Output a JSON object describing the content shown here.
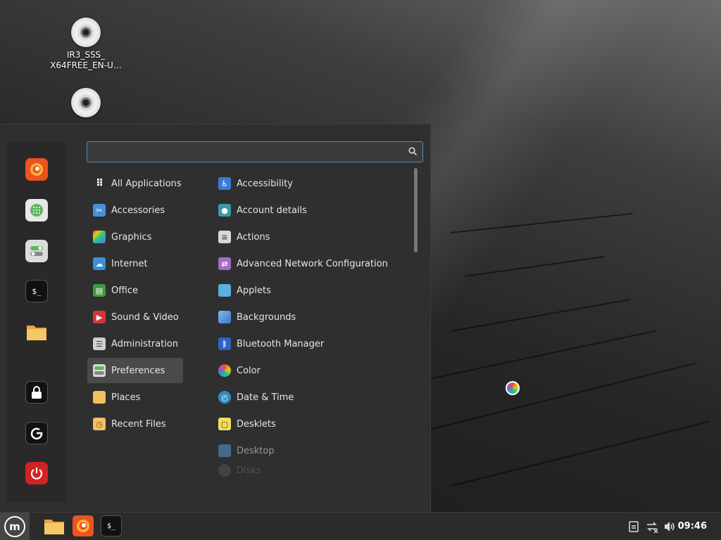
{
  "desktop": {
    "icons": [
      {
        "label": "IR3_SSS_\nX64FREE_EN-U…",
        "icon": "optical-disc-icon"
      },
      {
        "label": "",
        "icon": "optical-disc-icon"
      }
    ]
  },
  "menu": {
    "search": {
      "value": "",
      "placeholder": "",
      "icon": "search-icon"
    },
    "favorites": [
      {
        "name": "Firefox",
        "icon": "firefox-icon",
        "color": "#e95420"
      },
      {
        "name": "Software Manager",
        "icon": "software-manager-icon",
        "color": "#5cb85c"
      },
      {
        "name": "System Settings",
        "icon": "settings-toggle-icon",
        "color": "#d8d8d8"
      },
      {
        "name": "Terminal",
        "icon": "terminal-icon",
        "color": "#1e1e1e"
      },
      {
        "name": "Files",
        "icon": "folder-icon",
        "color": "#f3c060"
      },
      {
        "name": "Lock Screen",
        "icon": "lock-icon",
        "color": "#1a1a1a"
      },
      {
        "name": "Logout",
        "icon": "logout-icon",
        "color": "#1a1a1a"
      },
      {
        "name": "Quit",
        "icon": "power-icon",
        "color": "#d02323"
      }
    ],
    "categories": [
      {
        "label": "All Applications",
        "icon": "grid-icon"
      },
      {
        "label": "Accessories",
        "icon": "scissors-icon"
      },
      {
        "label": "Graphics",
        "icon": "graphics-icon"
      },
      {
        "label": "Internet",
        "icon": "cloud-icon"
      },
      {
        "label": "Office",
        "icon": "office-icon"
      },
      {
        "label": "Sound & Video",
        "icon": "play-icon"
      },
      {
        "label": "Administration",
        "icon": "administration-icon"
      },
      {
        "label": "Preferences",
        "icon": "preferences-icon",
        "selected": true
      },
      {
        "label": "Places",
        "icon": "folder-icon"
      },
      {
        "label": "Recent Files",
        "icon": "recent-folder-icon"
      }
    ],
    "applications": [
      {
        "label": "Accessibility",
        "icon": "accessibility-icon"
      },
      {
        "label": "Account details",
        "icon": "account-icon"
      },
      {
        "label": "Actions",
        "icon": "actions-icon"
      },
      {
        "label": "Advanced Network Configuration",
        "icon": "network-icon"
      },
      {
        "label": "Applets",
        "icon": "applets-icon"
      },
      {
        "label": "Backgrounds",
        "icon": "backgrounds-icon"
      },
      {
        "label": "Bluetooth Manager",
        "icon": "bluetooth-icon"
      },
      {
        "label": "Color",
        "icon": "color-icon"
      },
      {
        "label": "Date & Time",
        "icon": "clock-icon"
      },
      {
        "label": "Desklets",
        "icon": "desklets-icon"
      },
      {
        "label": "Desktop",
        "icon": "desktop-icon"
      },
      {
        "label": "Disks",
        "icon": "disks-icon"
      }
    ]
  },
  "panel": {
    "menu_button_icon": "linux-mint-logo-icon",
    "pinned": [
      {
        "name": "Files",
        "icon": "folder-icon"
      },
      {
        "name": "Firefox",
        "icon": "firefox-icon"
      },
      {
        "name": "Terminal",
        "icon": "terminal-icon"
      }
    ],
    "tray": [
      "notifications-icon",
      "network-disconnected-icon",
      "volume-icon"
    ],
    "clock": "09:46"
  }
}
